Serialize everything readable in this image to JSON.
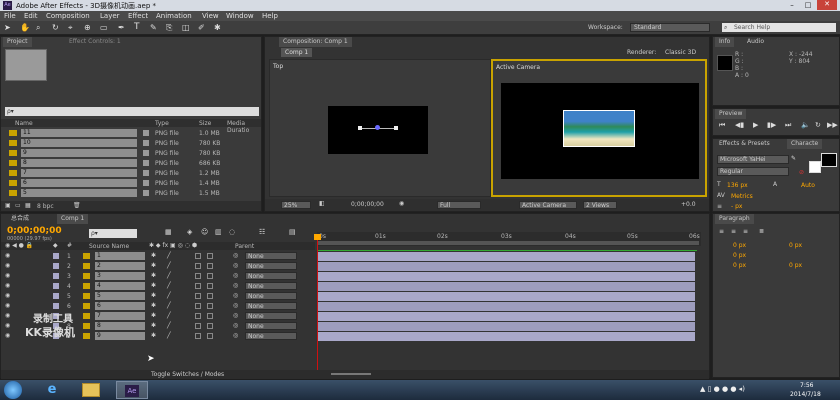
{
  "window": {
    "title": "Adobe After Effects - 3D摄像机动画.aep *",
    "logo": "Ae"
  },
  "menu": [
    "File",
    "Edit",
    "Composition",
    "Layer",
    "Effect",
    "Animation",
    "View",
    "Window",
    "Help"
  ],
  "toolbar": {
    "workspace_label": "Workspace:",
    "workspace_value": "Standard",
    "search_placeholder": "Search Help"
  },
  "project": {
    "tab": "Project",
    "tab2": "Effect Controls: 1",
    "search_placeholder": "ρ▾",
    "columns": [
      "Name",
      "Type",
      "Size",
      "Media Duratio"
    ],
    "items": [
      {
        "name": "11",
        "type": "PNG file",
        "size": "1.0 MB"
      },
      {
        "name": "10",
        "type": "PNG file",
        "size": "780 KB"
      },
      {
        "name": "9",
        "type": "PNG file",
        "size": "780 KB"
      },
      {
        "name": "8",
        "type": "PNG file",
        "size": "686 KB"
      },
      {
        "name": "7",
        "type": "PNG file",
        "size": "1.2 MB"
      },
      {
        "name": "6",
        "type": "PNG file",
        "size": "1.4 MB"
      },
      {
        "name": "5",
        "type": "PNG file",
        "size": "1.5 MB"
      }
    ],
    "bpc": "8 bpc"
  },
  "composition": {
    "tab": "Composition: Comp 1",
    "subtab": "Comp 1",
    "renderer_label": "Renderer:",
    "renderer_value": "Classic 3D",
    "view_left": "Top",
    "view_right": "Active Camera",
    "footer": {
      "zoom": "25%",
      "timecode": "0;00;00;00",
      "resolution": "Full",
      "camera": "Active Camera",
      "views": "2 Views",
      "offset": "+0.0"
    }
  },
  "info": {
    "tab1": "Info",
    "tab2": "Audio",
    "r": "R :",
    "g": "G :",
    "b": "B :",
    "a": "A : 0",
    "x": "X : -244",
    "y": "Y : 804"
  },
  "preview": {
    "tab": "Preview"
  },
  "character": {
    "tab1": "Effects & Presets",
    "tab2": "Characte",
    "font": "Microsoft YaHei",
    "style": "Regular",
    "size": "136 px",
    "leading": "Auto",
    "metrics": "Metrics",
    "stroke": "- px"
  },
  "paragraph": {
    "tab": "Paragraph",
    "vals": [
      "0 px",
      "0 px",
      "0 px",
      "0 px",
      "0 px"
    ]
  },
  "timeline": {
    "tab1": "总合成",
    "tab2": "Comp 1",
    "timecode": "0;00;00;00",
    "fps": "00000 (29.97 fps)",
    "search_placeholder": "ρ▾",
    "col_source": "Source Name",
    "col_parent": "Parent",
    "ruler": [
      "0s",
      "01s",
      "02s",
      "03s",
      "04s",
      "05s",
      "06s"
    ],
    "layers": [
      {
        "num": "1",
        "name": "1",
        "parent": "None"
      },
      {
        "num": "2",
        "name": "2",
        "parent": "None"
      },
      {
        "num": "3",
        "name": "3",
        "parent": "None"
      },
      {
        "num": "4",
        "name": "4",
        "parent": "None"
      },
      {
        "num": "5",
        "name": "5",
        "parent": "None"
      },
      {
        "num": "6",
        "name": "6",
        "parent": "None"
      },
      {
        "num": "7",
        "name": "7",
        "parent": "None"
      },
      {
        "num": "8",
        "name": "8",
        "parent": "None"
      },
      {
        "num": "9",
        "name": "9",
        "parent": "None"
      }
    ],
    "toggle_label": "Toggle Switches / Modes"
  },
  "watermark": {
    "line1": "录制工具",
    "line2": "KK录像机"
  },
  "taskbar": {
    "time": "7:56",
    "date": "2014/7/18",
    "app": "Ae"
  },
  "colors": {
    "accent": "#ffa800",
    "track": "#a9a8c9",
    "playhead": "#d01010"
  }
}
